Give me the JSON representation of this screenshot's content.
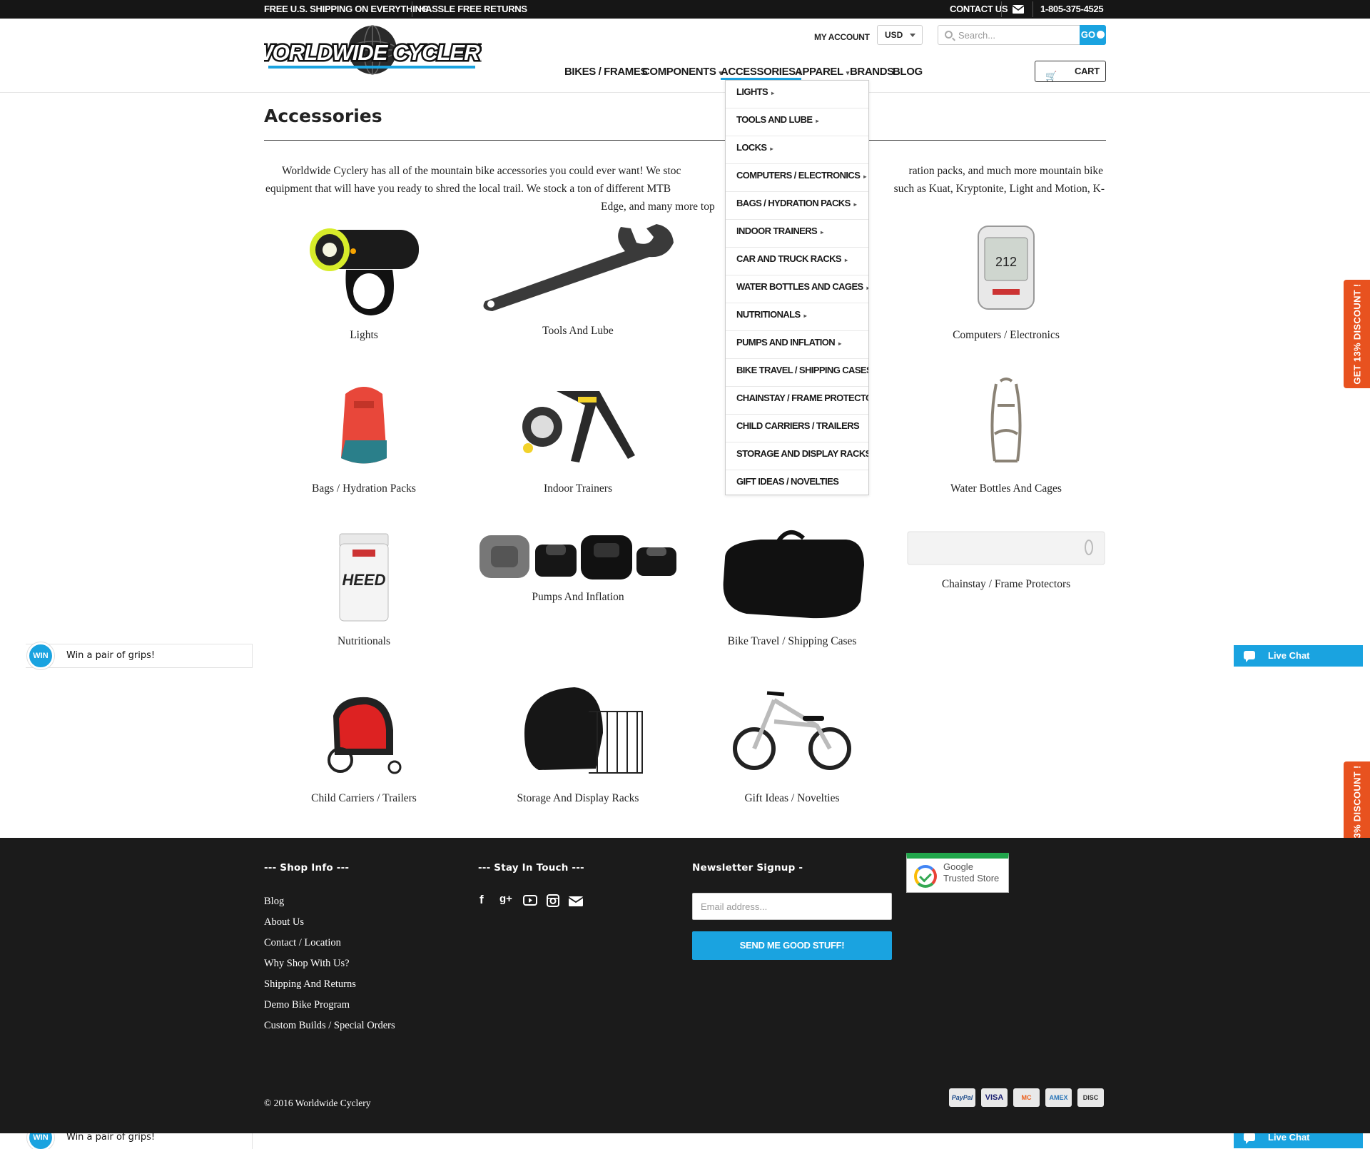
{
  "topbar": {
    "shipping": "FREE U.S. SHIPPING ON EVERYTHING",
    "returns": "HASSLE FREE RETURNS",
    "contact": "CONTACT US",
    "phone": "1-805-375-4525"
  },
  "header": {
    "logo_text": "WORLDWIDE CYCLERY",
    "my_account": "MY ACCOUNT",
    "currency": "USD",
    "search_placeholder": "Search...",
    "go_label": "GO",
    "cart_label": "CART",
    "nav": [
      "BIKES / FRAMES",
      "COMPONENTS",
      "ACCESSORIES",
      "APPAREL",
      "BRANDS",
      "BLOG"
    ]
  },
  "dropdown": [
    "LIGHTS",
    "TOOLS AND LUBE",
    "LOCKS",
    "COMPUTERS / ELECTRONICS",
    "BAGS / HYDRATION PACKS",
    "INDOOR TRAINERS",
    "CAR AND TRUCK RACKS",
    "WATER BOTTLES AND CAGES",
    "NUTRITIONALS",
    "PUMPS AND INFLATION",
    "BIKE TRAVEL / SHIPPING CASES",
    "CHAINSTAY / FRAME PROTECTORS",
    "CHILD CARRIERS / TRAILERS",
    "STORAGE AND DISPLAY RACKS",
    "GIFT IDEAS / NOVELTIES"
  ],
  "page": {
    "title": "Accessories",
    "intro_line1": "Worldwide Cyclery has all of the mountain bike accessories you could ever want! We stoc",
    "intro_line1b": "ration packs, and much more mountain bike",
    "intro_line2": "equipment that will have you ready to shred the local trail. We stock a ton of different MTB",
    "intro_line2b": "such as Kuat, Kryptonite, Light and Motion, K-",
    "intro_line3": "Edge, and many more top"
  },
  "categories": [
    "Lights",
    "Tools And Lube",
    "Computers / Electronics",
    "Bags / Hydration Packs",
    "Indoor Trainers",
    "Water Bottles And Cages",
    "Nutritionals",
    "Pumps And Inflation",
    "Bike Travel / Shipping Cases",
    "Chainstay / Frame Protectors",
    "Child Carriers / Trailers",
    "Storage And Display Racks",
    "Gift Ideas / Novelties"
  ],
  "widgets": {
    "discount": "GET 13% DISCOUNT !",
    "live_chat": "Live Chat",
    "win_badge": "WIN",
    "win_text": "Win a pair of grips!"
  },
  "footer": {
    "shop_info": "--- Shop Info ---",
    "stay_in_touch": "--- Stay In Touch ---",
    "newsletter": "Newsletter Signup -",
    "links": [
      "Blog",
      "About Us",
      "Contact / Location",
      "Why Shop With Us?",
      "Shipping And Returns",
      "Demo Bike Program",
      "Custom Builds / Special Orders"
    ],
    "email_placeholder": "Email address...",
    "submit": "SEND ME GOOD STUFF!",
    "trusted_line1": "Google",
    "trusted_line2": "Trusted Store",
    "copyright": "© 2016 Worldwide Cyclery",
    "payments": [
      "PayPal",
      "VISA",
      "MC",
      "AMEX",
      "DISC"
    ]
  },
  "colors": {
    "accent": "#1aa3e0",
    "discount": "#e8521f",
    "footer_bg": "#1b1b1b",
    "topbar_bg": "#161616"
  }
}
